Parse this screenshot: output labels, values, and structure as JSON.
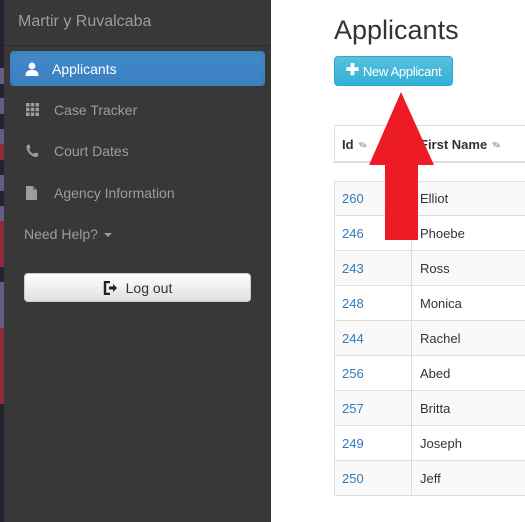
{
  "sidebar": {
    "brand": "Martir y Ruvalcaba",
    "items": [
      {
        "label": "Applicants",
        "icon": "user-icon",
        "active": true
      },
      {
        "label": "Case Tracker",
        "icon": "grid-icon",
        "active": false
      },
      {
        "label": "Court Dates",
        "icon": "phone-icon",
        "active": false
      },
      {
        "label": "Agency Information",
        "icon": "file-icon",
        "active": false
      }
    ],
    "help_label": "Need Help?",
    "logout_label": "Log out"
  },
  "main": {
    "title": "Applicants",
    "new_button_label": "New Applicant",
    "table": {
      "columns": [
        "Id",
        "First Name"
      ],
      "rows": [
        {
          "id": "260",
          "first_name": "Elliot"
        },
        {
          "id": "246",
          "first_name": "Phoebe"
        },
        {
          "id": "243",
          "first_name": "Ross"
        },
        {
          "id": "248",
          "first_name": "Monica"
        },
        {
          "id": "244",
          "first_name": "Rachel"
        },
        {
          "id": "256",
          "first_name": "Abed"
        },
        {
          "id": "257",
          "first_name": "Britta"
        },
        {
          "id": "249",
          "first_name": "Joseph"
        },
        {
          "id": "250",
          "first_name": "Jeff"
        }
      ]
    }
  },
  "annotation": {
    "type": "arrow",
    "direction": "up",
    "color": "#ed1c24",
    "points_to": "New Applicant"
  },
  "colors": {
    "sidebar_bg": "#383838",
    "active_nav": "#428bca",
    "info_button": "#5bc0de",
    "link": "#337ab7"
  }
}
